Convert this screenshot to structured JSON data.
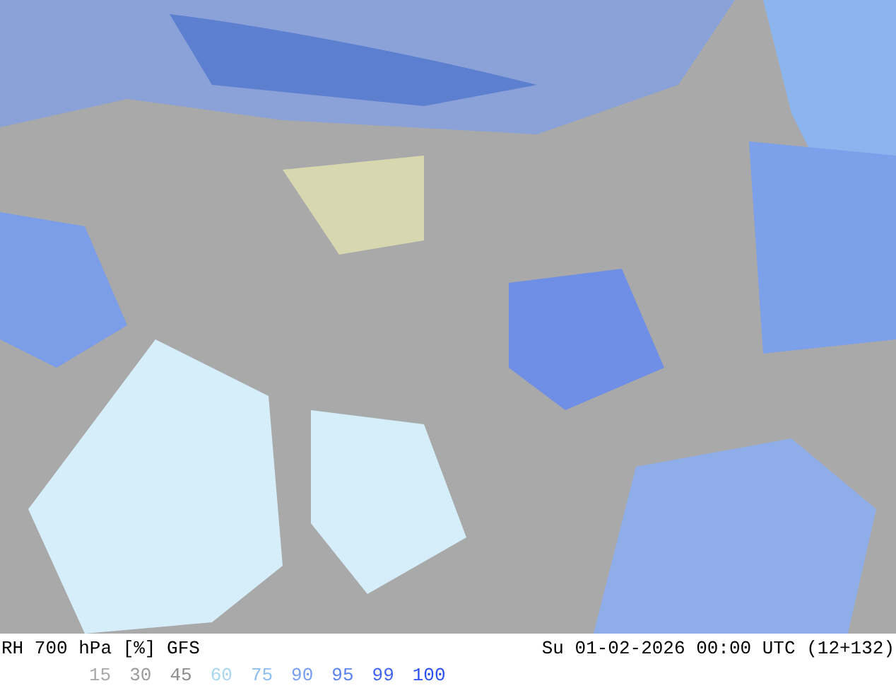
{
  "map": {
    "title": "RH 700 hPa [%] GFS",
    "valid_time": "Su 01-02-2026 00:00 UTC (12+132)"
  },
  "legend": [
    {
      "label": "15",
      "color": "#a8a8a8"
    },
    {
      "label": "30",
      "color": "#9c9c9c"
    },
    {
      "label": "45",
      "color": "#8c8c8c"
    },
    {
      "label": "60",
      "color": "#aad7f0"
    },
    {
      "label": "75",
      "color": "#8cbef0"
    },
    {
      "label": "90",
      "color": "#78a0f0"
    },
    {
      "label": "95",
      "color": "#5a82f0"
    },
    {
      "label": "99",
      "color": "#4164f0"
    },
    {
      "label": "100",
      "color": "#2d50f0"
    }
  ]
}
